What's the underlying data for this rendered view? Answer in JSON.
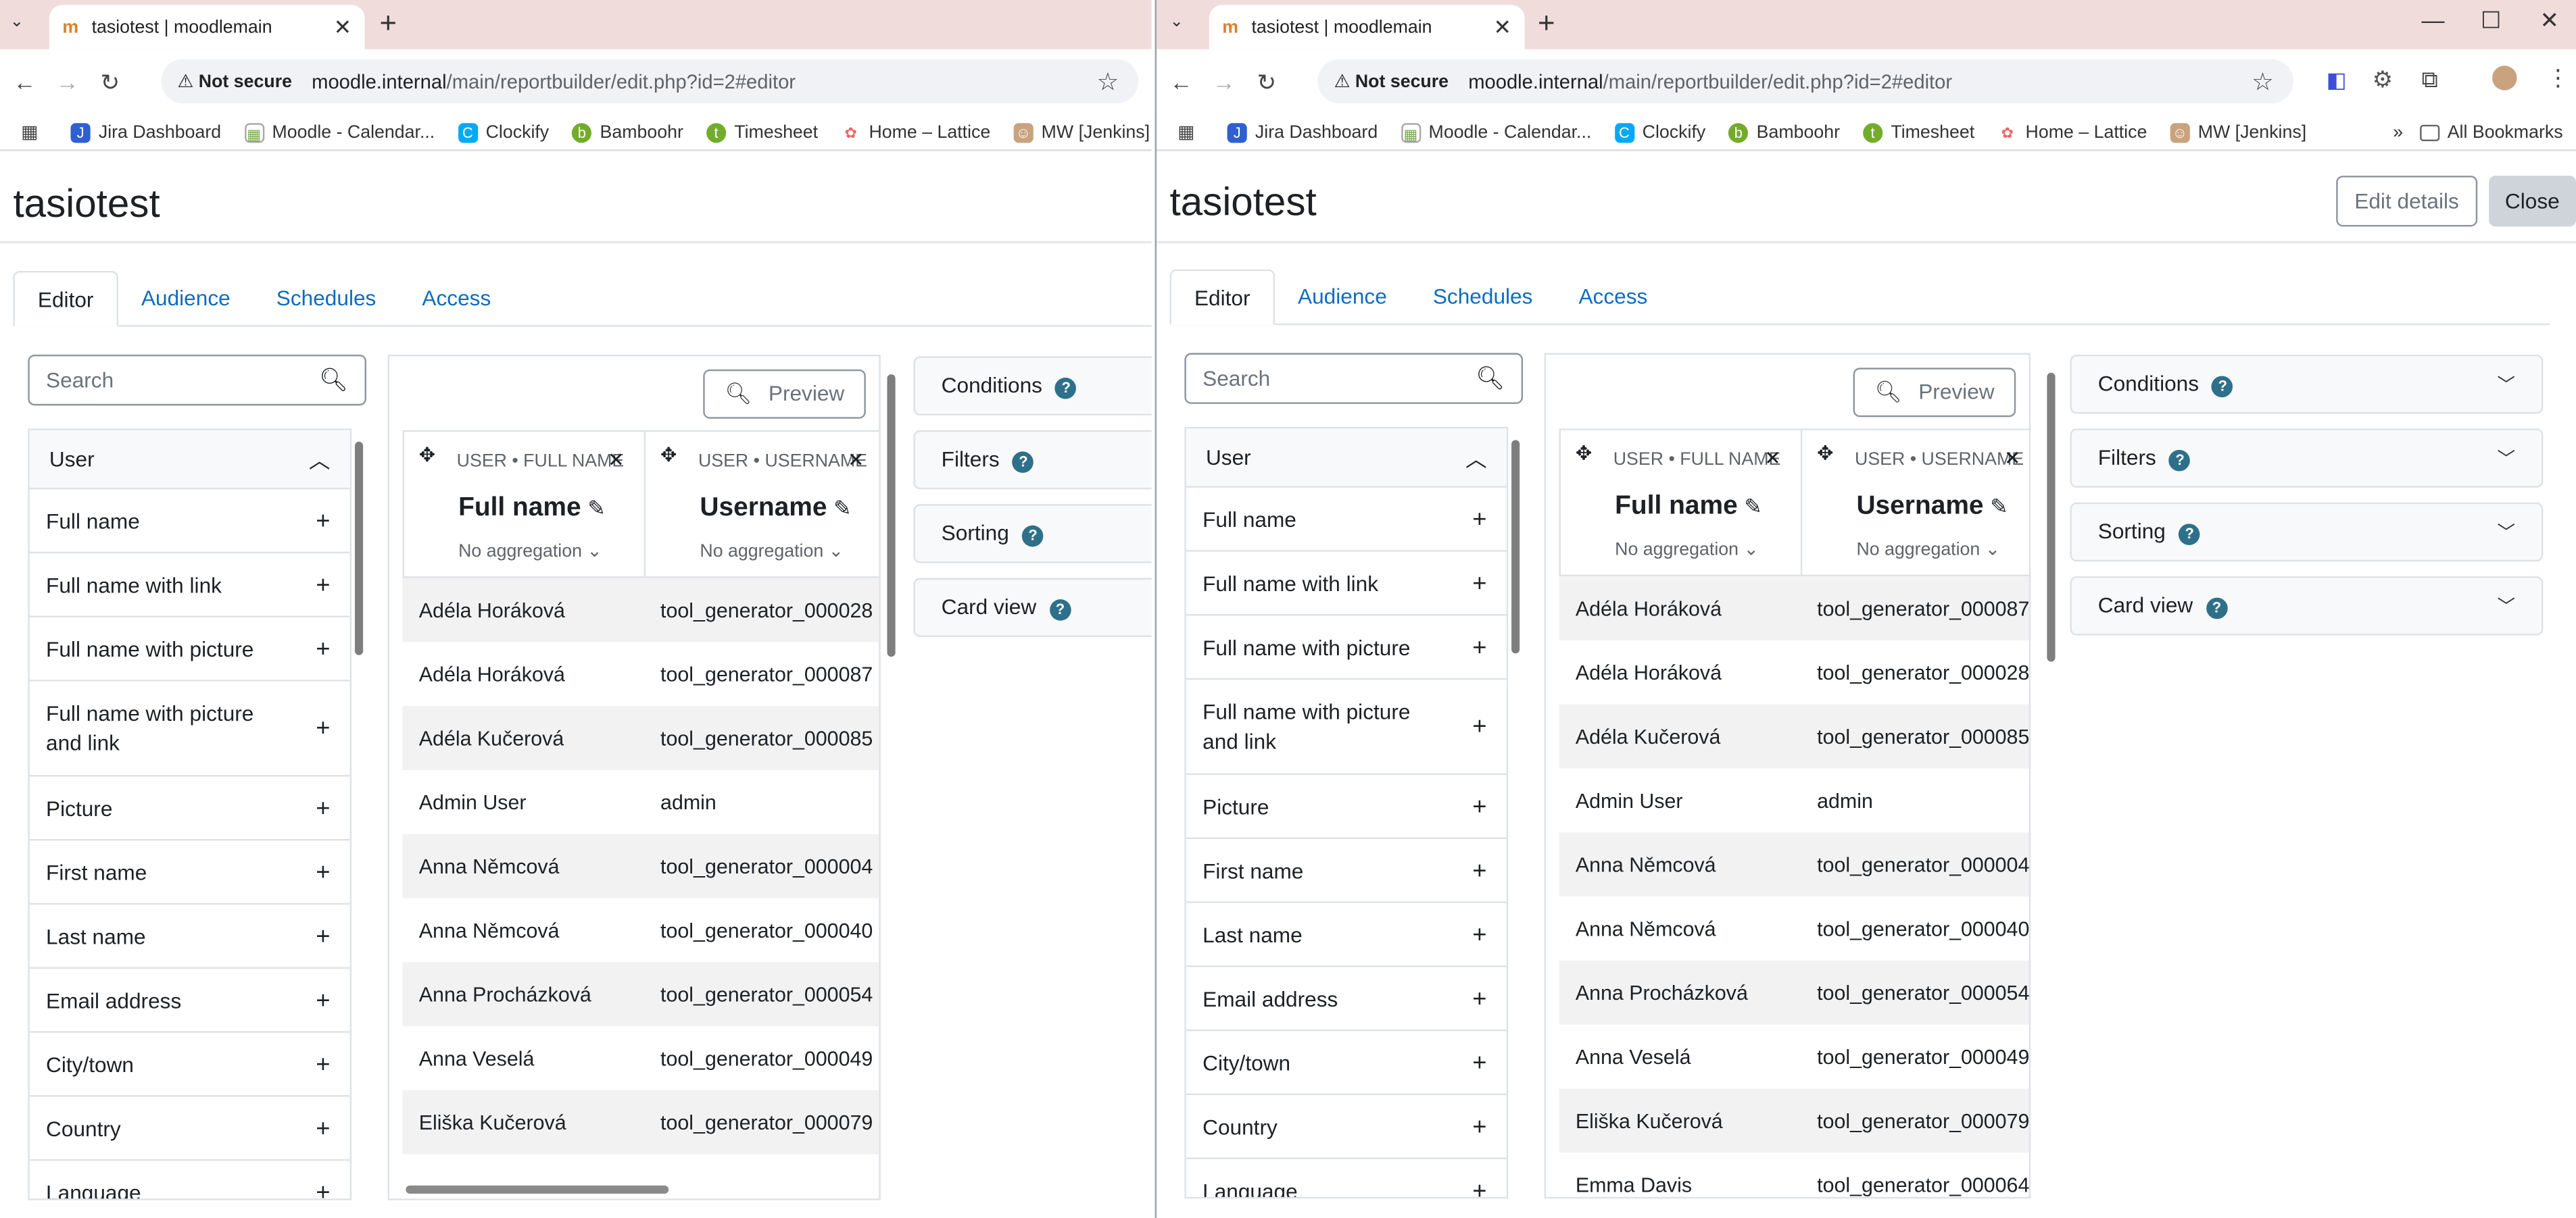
{
  "browser": {
    "tab_title": "tasiotest | moodlemain",
    "not_secure": "Not secure",
    "url_host": "moodle.internal",
    "url_path": "/main/reportbuilder/edit.php?id=2#editor",
    "bookmarks": [
      "Jira Dashboard",
      "Moodle - Calendar...",
      "Clockify",
      "Bamboohr",
      "Timesheet",
      "Home – Lattice",
      "MW [Jenkins]"
    ],
    "all_bookmarks": "All Bookmarks"
  },
  "page": {
    "title": "tasiotest",
    "edit_details": "Edit details",
    "close": "Close",
    "tabs": [
      "Editor",
      "Audience",
      "Schedules",
      "Access"
    ]
  },
  "search": {
    "placeholder": "Search"
  },
  "sidebar": {
    "group": "User",
    "items": [
      "Full name",
      "Full name with link",
      "Full name with picture",
      "Full name with picture and link",
      "Picture",
      "First name",
      "Last name",
      "Email address",
      "City/town",
      "Country",
      "Language"
    ]
  },
  "report": {
    "preview": "Preview",
    "columns": [
      {
        "source": "USER • FULL NAME",
        "name": "Full name",
        "aggregation": "No aggregation"
      },
      {
        "source": "USER • USERNAME",
        "name": "Username",
        "aggregation": "No aggregation"
      }
    ],
    "rows_left": [
      [
        "Adéla Horáková",
        "tool_generator_000028"
      ],
      [
        "Adéla Horáková",
        "tool_generator_000087"
      ],
      [
        "Adéla Kučerová",
        "tool_generator_000085"
      ],
      [
        "Admin User",
        "admin"
      ],
      [
        "Anna Němcová",
        "tool_generator_000004"
      ],
      [
        "Anna Němcová",
        "tool_generator_000040"
      ],
      [
        "Anna Procházková",
        "tool_generator_000054"
      ],
      [
        "Anna Veselá",
        "tool_generator_000049"
      ],
      [
        "Eliška Kučerová",
        "tool_generator_000079"
      ]
    ],
    "rows_right": [
      [
        "Adéla Horáková",
        "tool_generator_000087"
      ],
      [
        "Adéla Horáková",
        "tool_generator_000028"
      ],
      [
        "Adéla Kučerová",
        "tool_generator_000085"
      ],
      [
        "Admin User",
        "admin"
      ],
      [
        "Anna Němcová",
        "tool_generator_000004"
      ],
      [
        "Anna Němcová",
        "tool_generator_000040"
      ],
      [
        "Anna Procházková",
        "tool_generator_000054"
      ],
      [
        "Anna Veselá",
        "tool_generator_000049"
      ],
      [
        "Eliška Kučerová",
        "tool_generator_000079"
      ],
      [
        "Emma Davis",
        "tool_generator_000064"
      ]
    ]
  },
  "settings": {
    "sections": [
      "Conditions",
      "Filters",
      "Sorting",
      "Card view"
    ],
    "help": "?"
  },
  "colors": {
    "link": "#0f6cbf",
    "help_badge": "#2e7089",
    "tabstrip": "#f1dcdc"
  }
}
